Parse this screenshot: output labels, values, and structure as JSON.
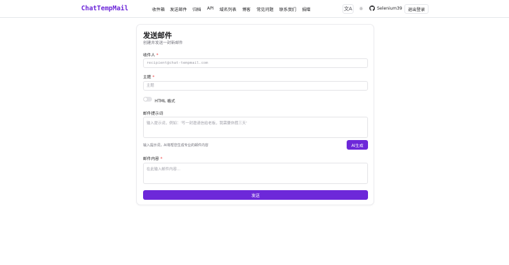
{
  "header": {
    "brand": "ChatTempMail",
    "nav": [
      "收件箱",
      "发送邮件",
      "归档",
      "API",
      "域名列表",
      "博客",
      "常见问题",
      "联系我们",
      "捐赠"
    ],
    "translate_icon": "文A",
    "theme_icon": "☼",
    "user_name": "Selenium39",
    "logout_label": "退出登录"
  },
  "form": {
    "title": "发送邮件",
    "subtitle": "创建并发送一封新邮件",
    "to_label": "收件人",
    "to_placeholder": "recipient@chat-tempmail.com",
    "subject_label": "主题",
    "subject_placeholder": "主题",
    "html_label": "HTML 格式",
    "html_enabled": false,
    "prompt_label": "邮件提示词",
    "prompt_placeholder": "输入提示词，例如：'写一封邀请信给老板，我需要休假三天'",
    "prompt_hint": "输入提示词，AI将帮您生成专业的邮件内容",
    "ai_button": "AI生成",
    "content_label": "邮件内容",
    "content_placeholder": "在此输入邮件内容...",
    "send_button": "发送",
    "required_mark": "*"
  },
  "colors": {
    "accent": "#6d28d9",
    "required": "#ef4444",
    "border": "#e4e4e7"
  }
}
